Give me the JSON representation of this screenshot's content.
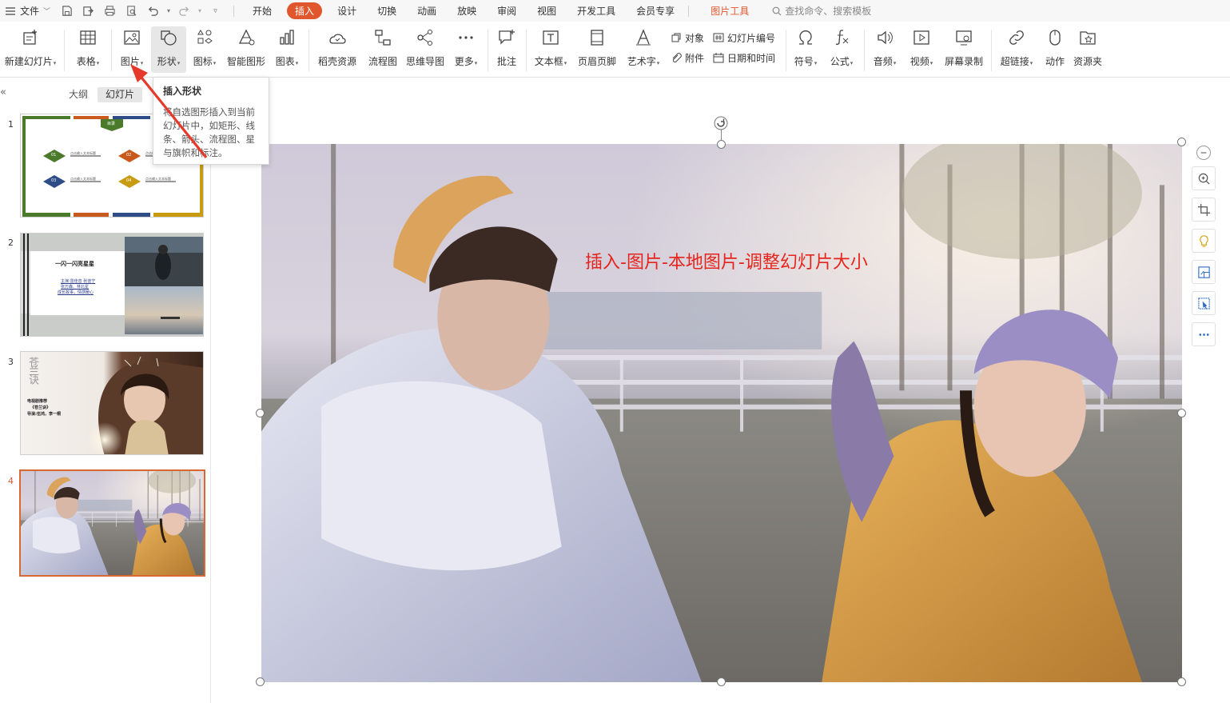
{
  "menubar": {
    "file_label": "文件",
    "tabs": [
      "开始",
      "插入",
      "设计",
      "切换",
      "动画",
      "放映",
      "审阅",
      "视图",
      "开发工具",
      "会员专享"
    ],
    "active_tab": "插入",
    "context_tab": "图片工具",
    "search_placeholder": "查找命令、搜索模板"
  },
  "ribbon": {
    "new_slide": "新建幻灯片",
    "table": "表格",
    "picture": "图片",
    "shape": "形状",
    "icon": "图标",
    "smartart": "智能图形",
    "chart": "图表",
    "docer": "稻壳资源",
    "flowchart": "流程图",
    "mindmap": "思维导图",
    "more": "更多",
    "comment": "批注",
    "textbox": "文本框",
    "header_footer": "页眉页脚",
    "wordart": "艺术字",
    "object": "对象",
    "attachment": "附件",
    "slide_number": "幻灯片编号",
    "date_time": "日期和时间",
    "symbol": "符号",
    "formula": "公式",
    "audio": "音频",
    "video": "视频",
    "screen_record": "屏幕录制",
    "hyperlink": "超链接",
    "action": "动作",
    "resource": "资源夹"
  },
  "leftpane": {
    "tab_outline": "大纲",
    "tab_slides": "幻灯片",
    "slides": [
      {
        "num": "1",
        "badge": "目录",
        "items": [
          "01",
          "02",
          "03",
          "04"
        ],
        "item_text": "点击输入文本标题"
      },
      {
        "num": "2",
        "title": "一闪一闪亮星星",
        "lines": [
          "主演:雷佳音 张佳宁",
          "张万森、林北星",
          "成长故事，情感暖心"
        ]
      },
      {
        "num": "3",
        "logo_text": "苍兰诀",
        "lines": [
          "电视剧推荐",
          "《苍兰诀》",
          "导演:伍鸿，李一桐"
        ]
      },
      {
        "num": "4"
      }
    ],
    "active_slide": "4"
  },
  "slide": {
    "overlay_text": "插入-图片-本地图片-调整幻灯片大小"
  },
  "tooltip": {
    "title": "插入形状",
    "body": "将自选图形插入到当前幻灯片中，如矩形、线条、箭头、流程图、星与旗帜和标注。"
  },
  "colors": {
    "accent": "#e0572d",
    "overlay_text": "#e5251c",
    "arrow": "#e53a2b"
  }
}
